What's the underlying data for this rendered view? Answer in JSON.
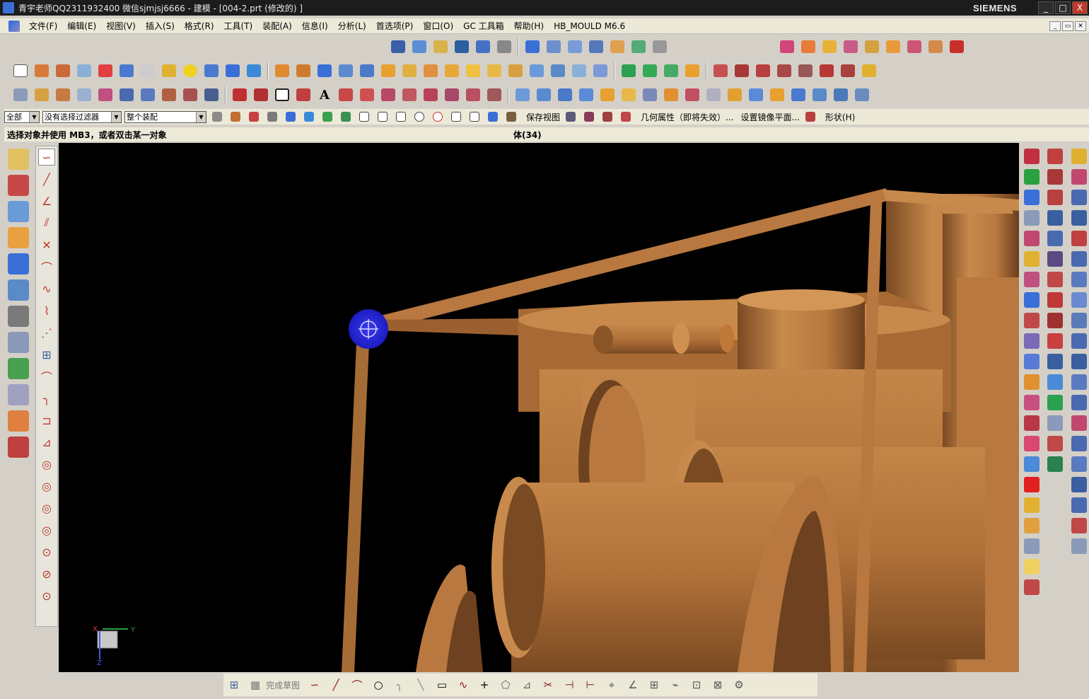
{
  "window": {
    "title": "青宇老师QQ2311932400 微信sjmjsj6666 - 建模 - [004-2.prt  (修改的) ]",
    "brand": "SIEMENS",
    "controls": [
      "_",
      "□",
      "X"
    ]
  },
  "menubar": {
    "items": [
      "文件(F)",
      "编辑(E)",
      "视图(V)",
      "插入(S)",
      "格式(R)",
      "工具(T)",
      "装配(A)",
      "信息(I)",
      "分析(L)",
      "首选项(P)",
      "窗口(O)",
      "GC 工具箱",
      "帮助(H)",
      "HB_MOULD M6.6"
    ]
  },
  "filterbar": {
    "type_filter": "全部",
    "selection_filter": "没有选择过滤器",
    "scope": "整个装配",
    "save_view": "保存视图",
    "geom_props": "几何属性（即将失效）...",
    "mirror_plane": "设置镜像平面...",
    "shape": "形状(H)"
  },
  "status": {
    "prompt": "选择对象并使用 MB3，或者双击某一对象",
    "info": "体(34)"
  },
  "sketch": {
    "finish_label": "完成草图"
  },
  "triad": {
    "x": "X",
    "y": "Y",
    "z": "Z"
  },
  "colors": {
    "model": "#b8783f",
    "viewport_bg": "#000000",
    "cursor_highlight": "#2323d8"
  }
}
